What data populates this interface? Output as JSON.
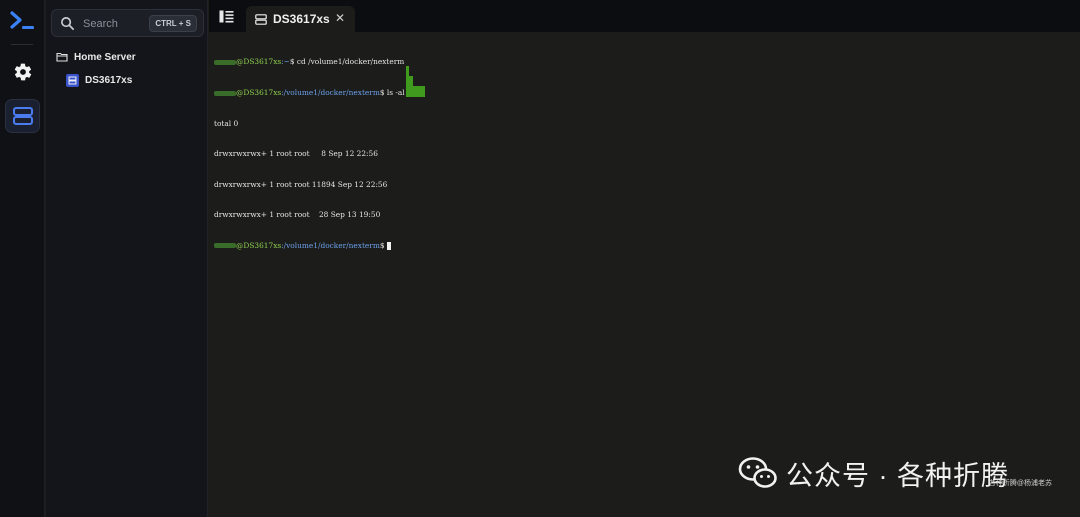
{
  "rail": {
    "logo_icon": "terminal-prompt-icon",
    "settings_icon": "gear-icon",
    "servers_icon": "server-stack-icon",
    "accent": "#3b82f6"
  },
  "sidebar": {
    "search": {
      "placeholder": "Search",
      "shortcut": "CTRL + S"
    },
    "folder": {
      "icon": "folder-icon",
      "label": "Home Server"
    },
    "servers": [
      {
        "icon": "server-icon",
        "label": "DS3617xs",
        "color": "#3b53c9"
      }
    ]
  },
  "tabs": [
    {
      "label": "DS3617xs",
      "icon": "server-icon",
      "close": "✕"
    }
  ],
  "terminal": {
    "line1": {
      "host": "@DS3617xs",
      "path": ":~",
      "cmd": "$ cd /volume1/docker/nexterm"
    },
    "line2": {
      "host": "@DS3617xs",
      "path": ":/volume1/docker/nexterm",
      "cmd": "$ ls -al"
    },
    "line3": "total 0",
    "line4": "drwxrwxrwx+ 1 root root     8 Sep 12 22:56",
    "line5": "drwxrwxrwx+ 1 root root 11894 Sep 12 22:56",
    "line6": "drwxrwxrwx+ 1 root root    28 Sep 13 19:50",
    "line7": {
      "host": "@DS3617xs",
      "path": ":/volume1/docker/nexterm",
      "cmd": "$ "
    }
  },
  "watermark": {
    "main": "公众号 · 各种折腾",
    "small": "各种折腾@杨浦老苏"
  }
}
